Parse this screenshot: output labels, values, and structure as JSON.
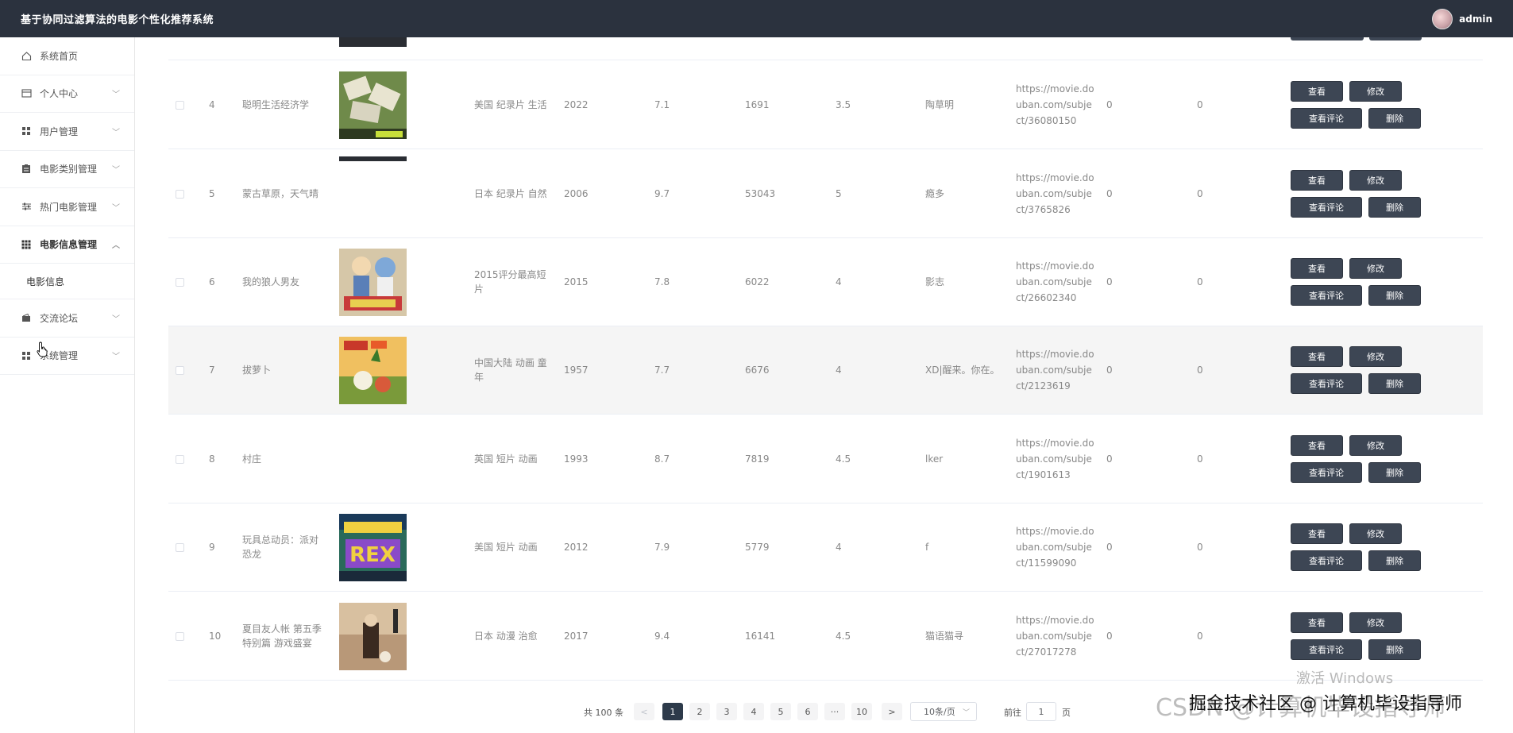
{
  "header": {
    "title": "基于协同过滤算法的电影个性化推荐系统",
    "username": "admin"
  },
  "sidebar": {
    "items": [
      {
        "label": "系统首页",
        "icon": "home-icon",
        "chevron": false
      },
      {
        "label": "个人中心",
        "icon": "window-icon",
        "chevron": true
      },
      {
        "label": "用户管理",
        "icon": "grid-icon",
        "chevron": true
      },
      {
        "label": "电影类别管理",
        "icon": "clipboard-icon",
        "chevron": true
      },
      {
        "label": "热门电影管理",
        "icon": "sliders-icon",
        "chevron": true
      },
      {
        "label": "电影信息管理",
        "icon": "apps-icon",
        "chevron": true,
        "open": true
      },
      {
        "label": "交流论坛",
        "icon": "wallet-icon",
        "chevron": true
      },
      {
        "label": "系统管理",
        "icon": "grid-icon",
        "chevron": true
      }
    ],
    "sub_item": "电影信息"
  },
  "table": {
    "rows": [
      {
        "index": "4",
        "name": [
          "聪明生活经济学"
        ],
        "has_poster": true,
        "poster": "money",
        "region": [
          "美国 纪录片 生活"
        ],
        "year": "2022",
        "score": "7.1",
        "votes": "1691",
        "rating": "3.5",
        "author": "陶草明",
        "link": [
          "https://movie.do",
          "uban.com/subje",
          "ct/36080150"
        ],
        "c1": "0",
        "c2": "0"
      },
      {
        "index": "5",
        "name": [
          "蒙古草原，天气晴"
        ],
        "has_poster": false,
        "poster": "",
        "region": [
          "日本 纪录片 自然"
        ],
        "year": "2006",
        "score": "9.7",
        "votes": "53043",
        "rating": "5",
        "author": "瘾多",
        "link": [
          "https://movie.do",
          "uban.com/subje",
          "ct/3765826"
        ],
        "c1": "0",
        "c2": "0"
      },
      {
        "index": "6",
        "name": [
          "我的狼人男友"
        ],
        "has_poster": true,
        "poster": "cartoon",
        "region": [
          "2015评分最高短",
          "片"
        ],
        "year": "2015",
        "score": "7.8",
        "votes": "6022",
        "rating": "4",
        "author": "影志",
        "link": [
          "https://movie.do",
          "uban.com/subje",
          "ct/26602340"
        ],
        "c1": "0",
        "c2": "0"
      },
      {
        "index": "7",
        "name": [
          "拔萝卜"
        ],
        "has_poster": true,
        "poster": "radish",
        "region": [
          "中国大陆 动画 童",
          "年"
        ],
        "year": "1957",
        "score": "7.7",
        "votes": "6676",
        "rating": "4",
        "author": "XD|醒来。你在。",
        "link": [
          "https://movie.do",
          "uban.com/subje",
          "ct/2123619"
        ],
        "c1": "0",
        "c2": "0"
      },
      {
        "index": "8",
        "name": [
          "村庄"
        ],
        "has_poster": false,
        "poster": "",
        "region": [
          "英国 短片 动画"
        ],
        "year": "1993",
        "score": "8.7",
        "votes": "7819",
        "rating": "4.5",
        "author": "lker",
        "link": [
          "https://movie.do",
          "uban.com/subje",
          "ct/1901613"
        ],
        "c1": "0",
        "c2": "0"
      },
      {
        "index": "9",
        "name": [
          "玩具总动员：派对",
          "恐龙"
        ],
        "has_poster": true,
        "poster": "rex",
        "region": [
          "美国 短片 动画"
        ],
        "year": "2012",
        "score": "7.9",
        "votes": "5779",
        "rating": "4",
        "author": "f",
        "link": [
          "https://movie.do",
          "uban.com/subje",
          "ct/11599090"
        ],
        "c1": "0",
        "c2": "0"
      },
      {
        "index": "10",
        "name": [
          "夏目友人帐 第五季",
          "特别篇 游戏盛宴"
        ],
        "has_poster": true,
        "poster": "natsume",
        "region": [
          "日本 动漫 治愈"
        ],
        "year": "2017",
        "score": "9.4",
        "votes": "16141",
        "rating": "4.5",
        "author": "猫语猫寻",
        "link": [
          "https://movie.do",
          "uban.com/subje",
          "ct/27017278"
        ],
        "c1": "0",
        "c2": "0"
      }
    ],
    "actions": {
      "view": "查看",
      "edit": "修改",
      "view_comments": "查看评论",
      "delete": "删除"
    }
  },
  "pagination": {
    "total": "共 100 条",
    "prev": "<",
    "pages": [
      "1",
      "2",
      "3",
      "4",
      "5",
      "6",
      "···",
      "10"
    ],
    "active_page": "1",
    "next": ">",
    "page_size": "10条/页",
    "goto_label": "前往",
    "goto_value": "1",
    "goto_suffix": "页"
  },
  "watermarks": {
    "activate": "激活 Windows",
    "csdn": "CSDN @计算机毕设指导师",
    "juejin": "掘金技术社区 @ 计算机毕设指导师"
  }
}
